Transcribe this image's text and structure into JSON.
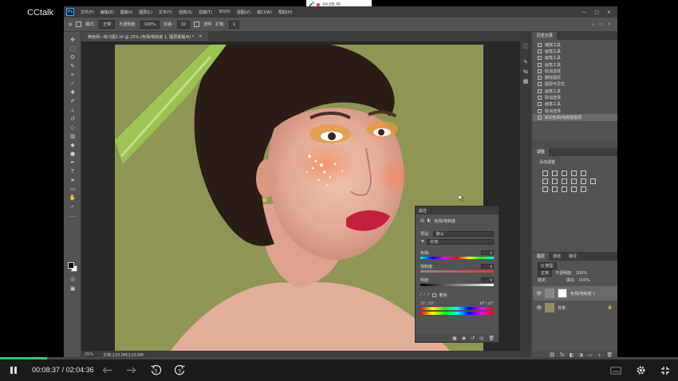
{
  "player": {
    "logo": "CCtalk",
    "recording_time": "00:08:36",
    "current_time": "00:08:37",
    "separator": "/",
    "total_time": "02:04:36",
    "progress": 0.069,
    "skip_back_label": "5",
    "skip_forward_label": "5",
    "accent_color": "#2fc96b"
  },
  "photoshop": {
    "logo": "Ps",
    "menu": [
      "文件(F)",
      "编辑(E)",
      "图像(I)",
      "图层(L)",
      "文字(Y)",
      "选择(S)",
      "滤镜(T)",
      "3D(D)",
      "视图(V)",
      "窗口(W)",
      "帮助(H)"
    ],
    "options": {
      "mode_label": "模式:",
      "mode_value": "正常",
      "opacity_label": "不透明度:",
      "opacity_value": "100%",
      "tolerance_label": "容差:",
      "tolerance_value": "32",
      "transparent_label": "透明",
      "extend_label": "扩散:",
      "extend_value": "1"
    },
    "document_tab": "换色例—练习图1.tif @ 25% (色相/饱和度 1, 图层蒙版/8) *",
    "status": {
      "zoom": "25%",
      "doc": "文档:120.0M/120.0M"
    },
    "history": {
      "tabs": [
        "历史记录"
      ],
      "items": [
        "缩放工具",
        "画笔工具",
        "画笔工具",
        "画笔工具",
        "取消选择",
        "删除图层",
        "图层可见性",
        "画笔工具",
        "取消选择",
        "画笔工具",
        "取消选择",
        "新的色相/饱和度图层"
      ],
      "selected_index": 11
    },
    "adjustments": {
      "tab": "调整",
      "label": "添加调整"
    },
    "layers": {
      "tabs": [
        "图层",
        "通道",
        "路径"
      ],
      "kind_label": "Q 类型",
      "blend": "正常",
      "opacity_label": "不透明度:",
      "opacity_value": "100%",
      "lock_label": "锁定:",
      "fill_label": "填充:",
      "fill_value": "100%",
      "list": [
        {
          "name": "色相/饱和度 1",
          "selected": true
        },
        {
          "name": "背景",
          "selected": false
        }
      ]
    },
    "properties": {
      "title": "属性",
      "subtitle": "色相/饱和度",
      "preset_label": "预设:",
      "preset_value": "默认",
      "channel_value": "红色",
      "hue_label": "色相:",
      "hue_value": "0",
      "saturation_label": "饱和度:",
      "saturation_value": "0",
      "lightness_label": "明度:",
      "lightness_value": "0",
      "colorize_label": "着色",
      "range_left": "15° / 45°",
      "range_right": "30° \\ 45°"
    }
  }
}
